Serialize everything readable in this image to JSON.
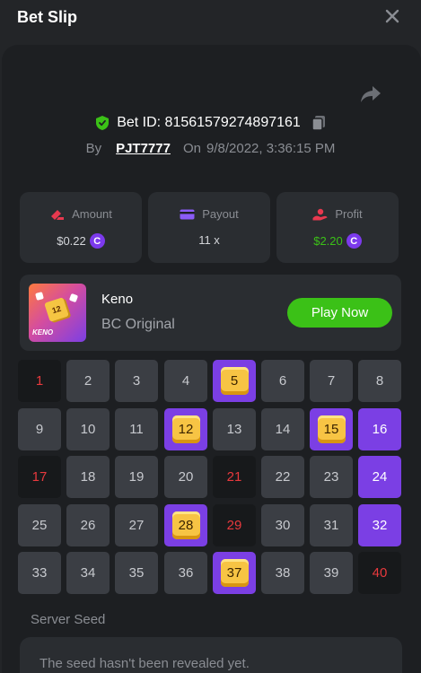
{
  "header": {
    "title": "Bet Slip"
  },
  "bet": {
    "id_label": "Bet ID: 81561579274897161",
    "by_label": "By",
    "user": "PJT7777",
    "on_label": "On",
    "date": "9/8/2022, 3:36:15 PM"
  },
  "stats": {
    "amount": {
      "label": "Amount",
      "value": "$0.22",
      "coin": "C"
    },
    "payout": {
      "label": "Payout",
      "value": "11 x"
    },
    "profit": {
      "label": "Profit",
      "value": "$2.20",
      "coin": "C"
    }
  },
  "game": {
    "thumb_number": "12",
    "thumb_logo": "KENO",
    "name": "Keno",
    "subtitle": "BC Original",
    "play_label": "Play Now"
  },
  "grid": {
    "cells": [
      {
        "n": "1",
        "s": "miss"
      },
      {
        "n": "2",
        "s": "plain"
      },
      {
        "n": "3",
        "s": "plain"
      },
      {
        "n": "4",
        "s": "plain"
      },
      {
        "n": "5",
        "s": "hit"
      },
      {
        "n": "6",
        "s": "plain"
      },
      {
        "n": "7",
        "s": "plain"
      },
      {
        "n": "8",
        "s": "plain"
      },
      {
        "n": "9",
        "s": "plain"
      },
      {
        "n": "10",
        "s": "plain"
      },
      {
        "n": "11",
        "s": "plain"
      },
      {
        "n": "12",
        "s": "hit"
      },
      {
        "n": "13",
        "s": "plain"
      },
      {
        "n": "14",
        "s": "plain"
      },
      {
        "n": "15",
        "s": "hit"
      },
      {
        "n": "16",
        "s": "sel"
      },
      {
        "n": "17",
        "s": "miss"
      },
      {
        "n": "18",
        "s": "plain"
      },
      {
        "n": "19",
        "s": "plain"
      },
      {
        "n": "20",
        "s": "plain"
      },
      {
        "n": "21",
        "s": "miss"
      },
      {
        "n": "22",
        "s": "plain"
      },
      {
        "n": "23",
        "s": "plain"
      },
      {
        "n": "24",
        "s": "sel"
      },
      {
        "n": "25",
        "s": "plain"
      },
      {
        "n": "26",
        "s": "plain"
      },
      {
        "n": "27",
        "s": "plain"
      },
      {
        "n": "28",
        "s": "hit"
      },
      {
        "n": "29",
        "s": "miss"
      },
      {
        "n": "30",
        "s": "plain"
      },
      {
        "n": "31",
        "s": "plain"
      },
      {
        "n": "32",
        "s": "sel"
      },
      {
        "n": "33",
        "s": "plain"
      },
      {
        "n": "34",
        "s": "plain"
      },
      {
        "n": "35",
        "s": "plain"
      },
      {
        "n": "36",
        "s": "plain"
      },
      {
        "n": "37",
        "s": "hit"
      },
      {
        "n": "38",
        "s": "plain"
      },
      {
        "n": "39",
        "s": "plain"
      },
      {
        "n": "40",
        "s": "miss"
      }
    ]
  },
  "seed": {
    "label": "Server Seed",
    "text": "The seed hasn't been revealed yet."
  },
  "colors": {
    "accent_purple": "#7b3fe4",
    "accent_green": "#3bc117",
    "miss_red": "#e8393d",
    "gem_gold": "#f7c444"
  }
}
